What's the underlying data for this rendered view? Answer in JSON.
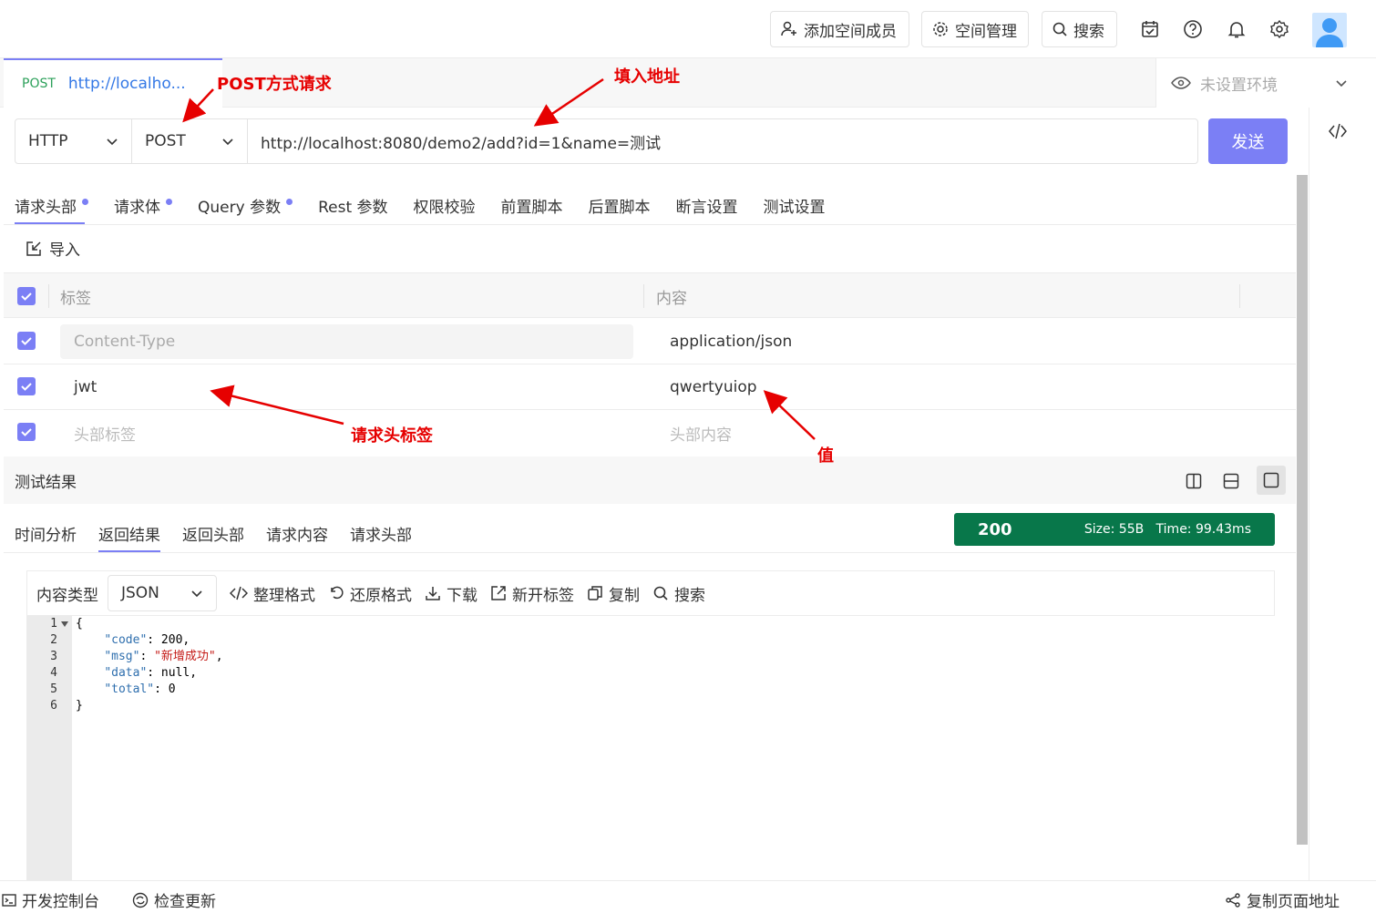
{
  "header": {
    "add_member": "添加空间成员",
    "space_manage": "空间管理",
    "search": "搜索"
  },
  "tab": {
    "method": "POST",
    "url": "http://localho..."
  },
  "env": {
    "label": "未设置环境"
  },
  "request": {
    "protocol": "HTTP",
    "method": "POST",
    "url": "http://localhost:8080/demo2/add?id=1&name=测试",
    "send": "发送"
  },
  "subtabs": [
    {
      "label": "请求头部",
      "dot": true
    },
    {
      "label": "请求体",
      "dot": true
    },
    {
      "label": "Query 参数",
      "dot": true
    },
    {
      "label": "Rest 参数",
      "dot": false
    },
    {
      "label": "权限校验",
      "dot": false
    },
    {
      "label": "前置脚本",
      "dot": false
    },
    {
      "label": "后置脚本",
      "dot": false
    },
    {
      "label": "断言设置",
      "dot": false
    },
    {
      "label": "测试设置",
      "dot": false
    }
  ],
  "import_label": "导入",
  "table": {
    "col_key": "标签",
    "col_value": "内容",
    "rows": [
      {
        "key": "Content-Type",
        "value": "application/json"
      },
      {
        "key": "jwt",
        "value": "qwertyuiop"
      }
    ],
    "placeholder_key": "头部标签",
    "placeholder_value": "头部内容"
  },
  "results": {
    "title": "测试结果",
    "tabs": [
      "时间分析",
      "返回结果",
      "返回头部",
      "请求内容",
      "请求头部"
    ],
    "status_code": "200",
    "meta": "Size: 55B   Time: 99.43ms",
    "content_type_label": "内容类型",
    "content_type": "JSON",
    "tools": [
      "整理格式",
      "还原格式",
      "下载",
      "新开标签",
      "复制",
      "搜索"
    ]
  },
  "code_lines": [
    "1",
    "2",
    "3",
    "4",
    "5",
    "6"
  ],
  "code": {
    "open": "{",
    "close": "}",
    "k_code": "\"code\"",
    "v_code": " 200,",
    "k_msg": "\"msg\"",
    "v_msg": "\"新增成功\"",
    "k_data": "\"data\"",
    "v_data": " null,",
    "k_total": "\"total\"",
    "v_total": " 0"
  },
  "footer": {
    "console": "开发控制台",
    "check_update": "检查更新",
    "copy_url": "复制页面地址"
  },
  "annotations": {
    "post": "POST方式请求",
    "fill_url": "填入地址",
    "header_key": "请求头标签",
    "value": "值"
  },
  "colors": {
    "accent": "#7b7ff5",
    "status": "#08774a",
    "annotation": "#e60000"
  }
}
